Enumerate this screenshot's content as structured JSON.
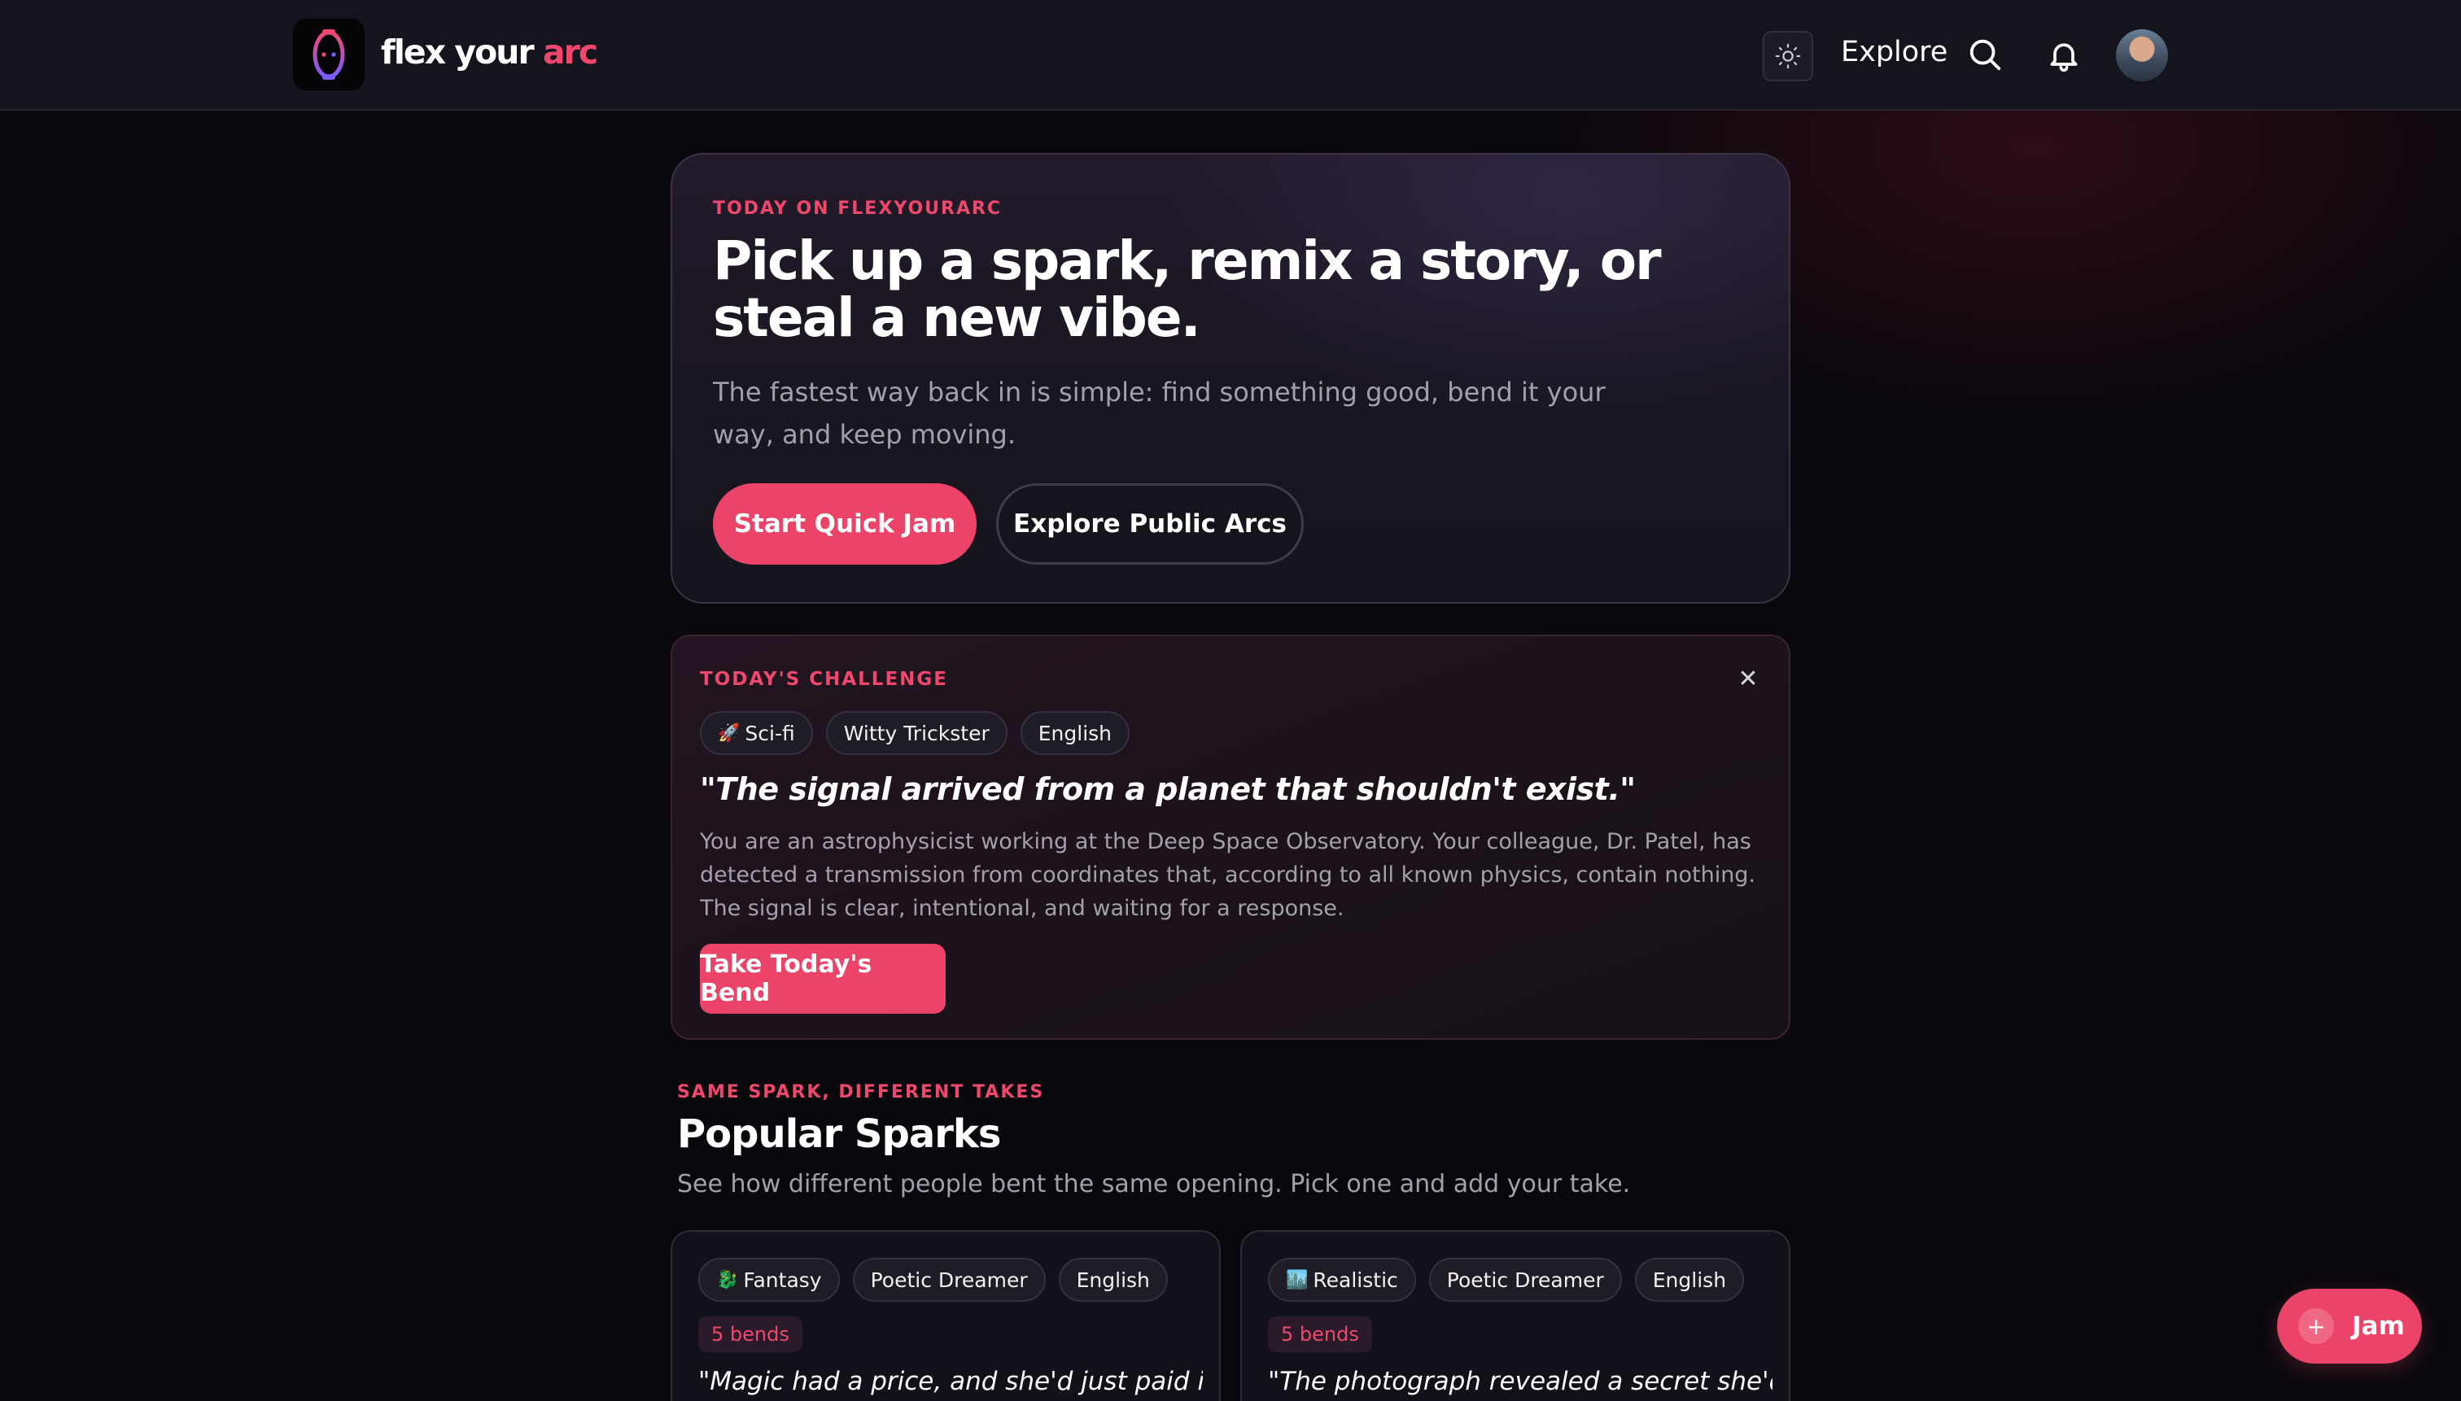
{
  "header": {
    "brand_main": "flex your ",
    "brand_accent": "arc",
    "logo_icon": "arc-logo-icon",
    "theme_toggle_icon": "sun-icon",
    "explore_label": "Explore",
    "search_icon": "search-icon",
    "notifications_icon": "bell-icon",
    "avatar_icon": "user-avatar"
  },
  "hero": {
    "eyebrow": "TODAY ON FLEXYOURARC",
    "title": "Pick up a spark, remix a story, or steal a new vibe.",
    "subtitle": "The fastest way back in is simple: find something good, bend it your way, and keep moving.",
    "primary_cta": "Start Quick Jam",
    "secondary_cta": "Explore Public Arcs"
  },
  "challenge": {
    "eyebrow": "TODAY'S CHALLENGE",
    "close_icon": "close-icon",
    "tags": [
      {
        "emoji": "🚀",
        "label": "Sci-fi"
      },
      {
        "emoji": "",
        "label": "Witty Trickster"
      },
      {
        "emoji": "",
        "label": "English"
      }
    ],
    "quote": "\"The signal arrived from a planet that shouldn't exist.\"",
    "body": "You are an astrophysicist working at the Deep Space Observatory. Your colleague, Dr. Patel, has detected a transmission from coordinates that, according to all known physics, contain nothing. The signal is clear, intentional, and waiting for a response.",
    "cta": "Take Today's Bend"
  },
  "popular": {
    "eyebrow": "SAME SPARK, DIFFERENT TAKES",
    "title": "Popular Sparks",
    "subtitle": "See how different people bent the same opening. Pick one and add your take.",
    "cards": [
      {
        "tags": [
          {
            "emoji": "🐉",
            "label": "Fantasy"
          },
          {
            "emoji": "",
            "label": "Poetic Dreamer"
          },
          {
            "emoji": "",
            "label": "English"
          }
        ],
        "bends": "5 bends",
        "quote": "\"Magic had a price, and she'd just paid it.\""
      },
      {
        "tags": [
          {
            "emoji": "🏙️",
            "label": "Realistic"
          },
          {
            "emoji": "",
            "label": "Poetic Dreamer"
          },
          {
            "emoji": "",
            "label": "English"
          }
        ],
        "bends": "5 bends",
        "quote": "\"The photograph revealed a secret she'd kept"
      }
    ]
  },
  "fab": {
    "icon": "plus-icon",
    "label": "Jam"
  },
  "colors": {
    "accent": "#ec4468",
    "background": "#08080d",
    "topbar": "#14141d"
  }
}
